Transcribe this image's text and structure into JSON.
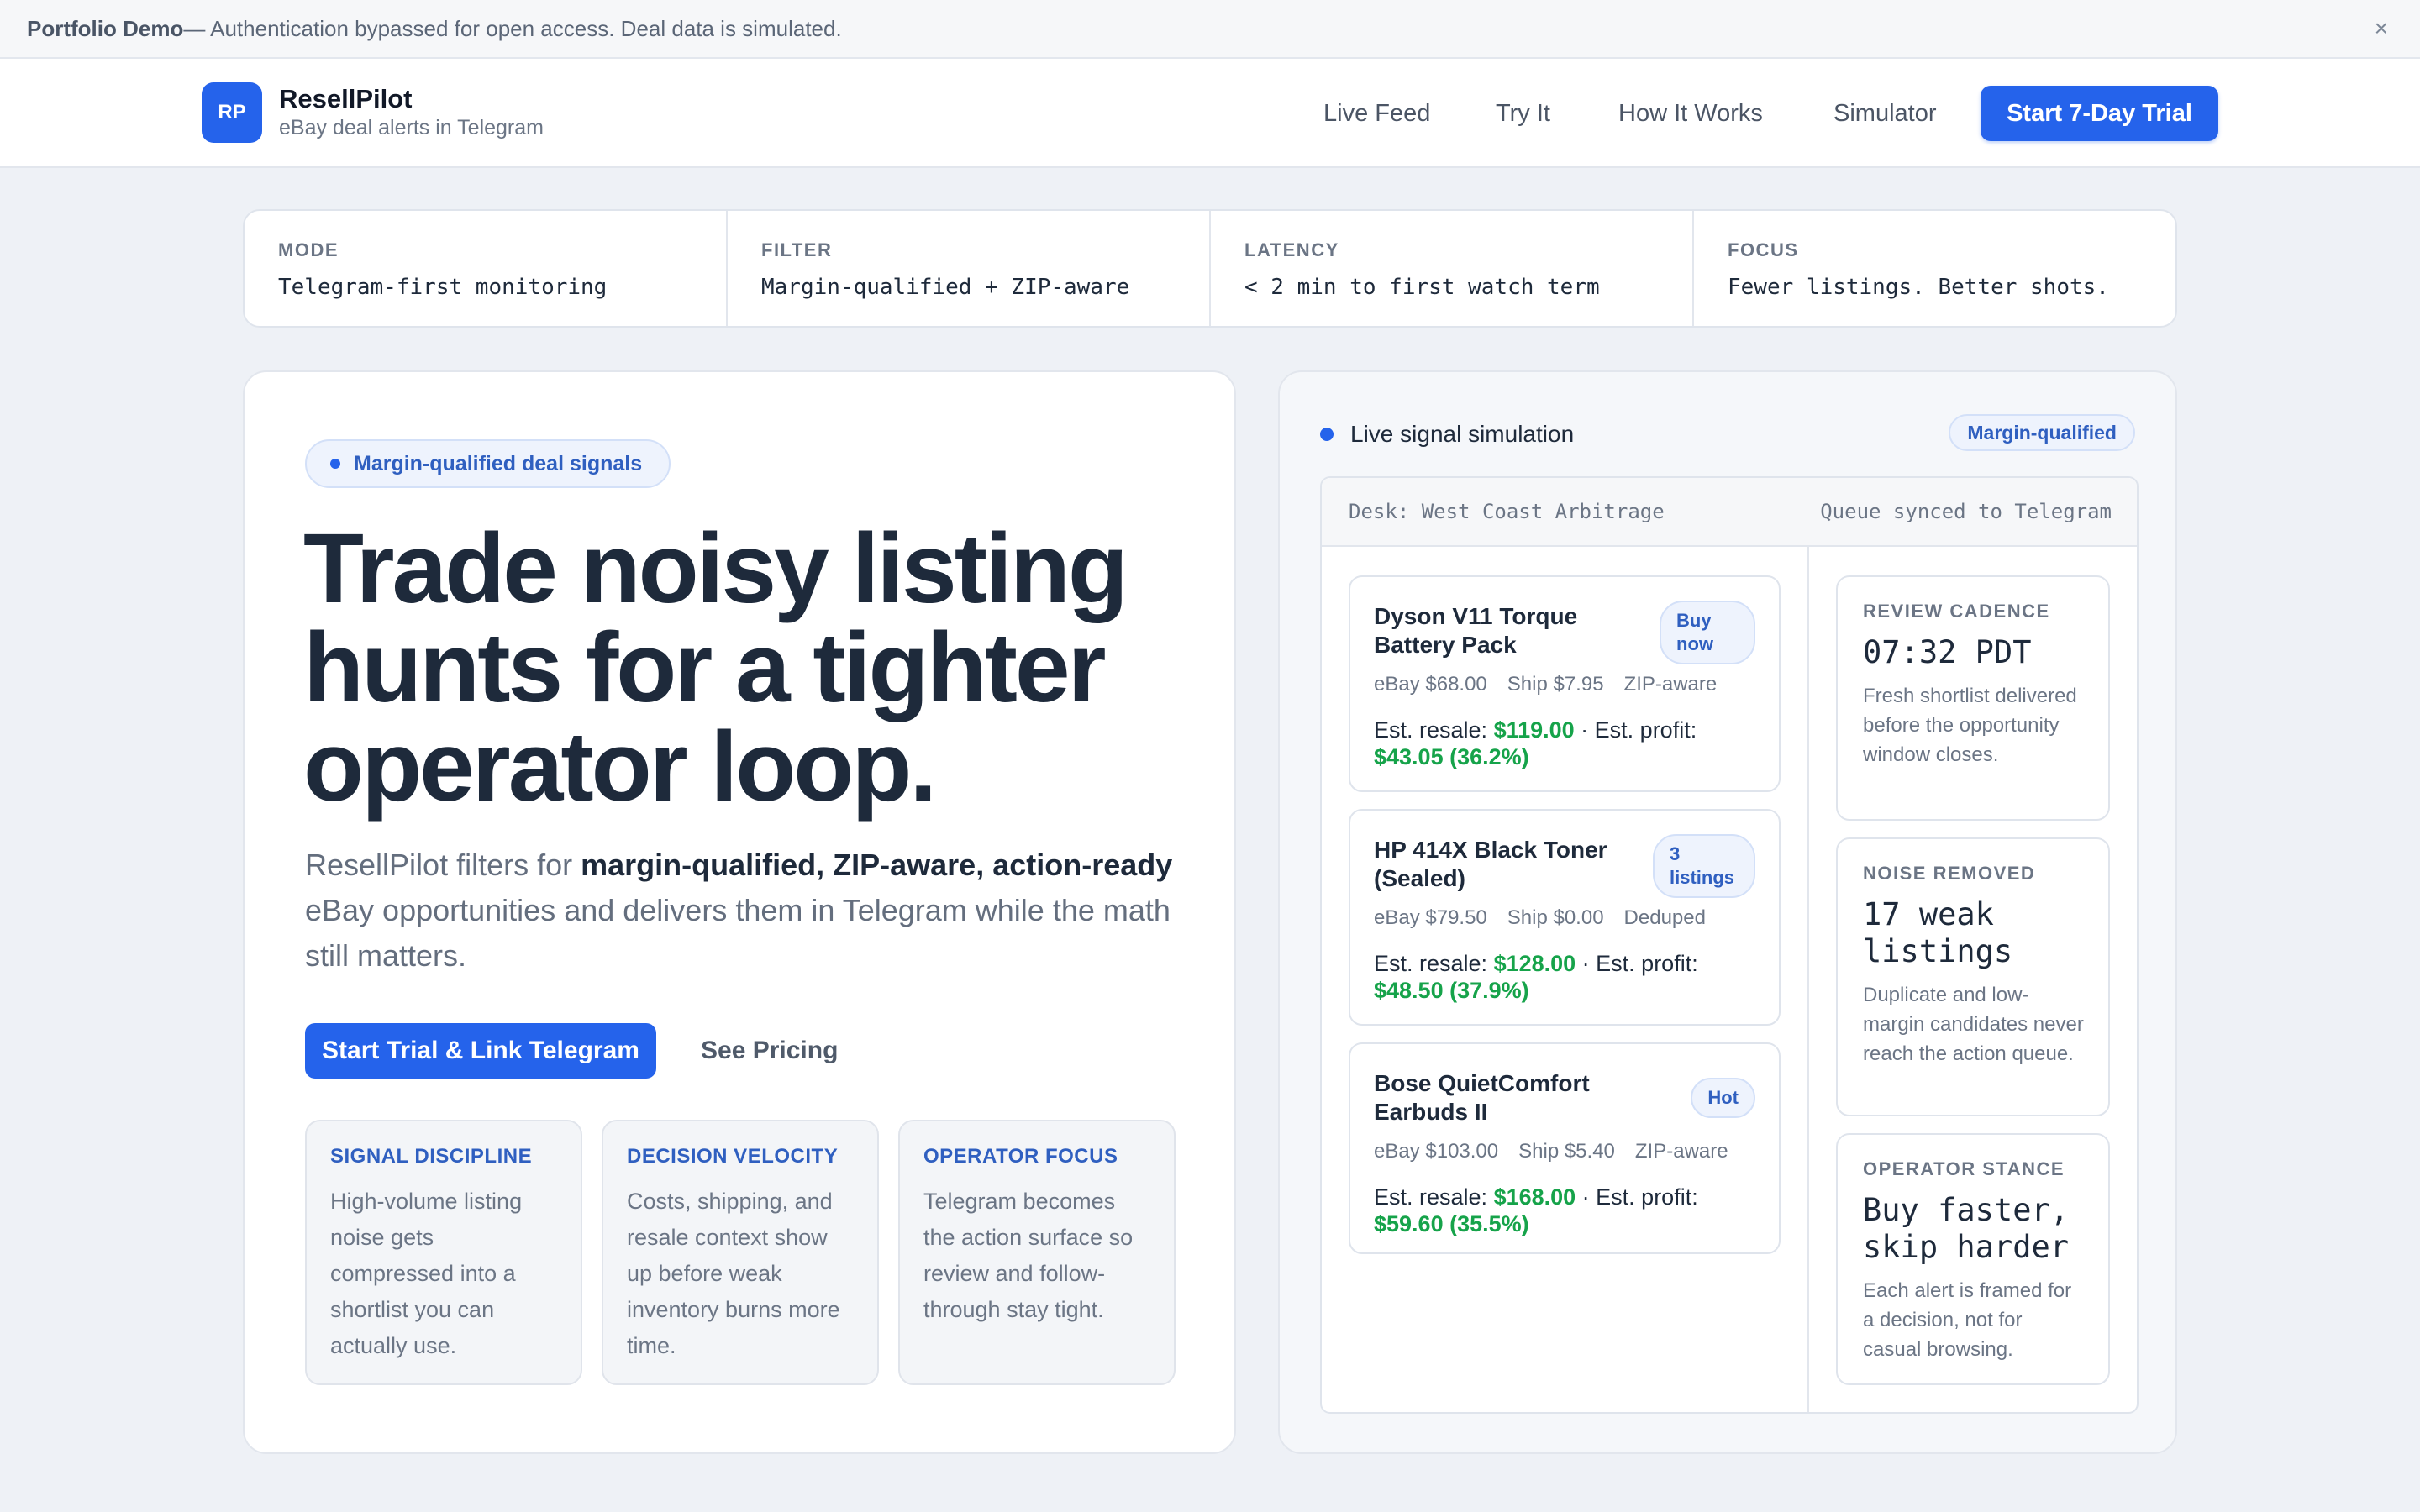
{
  "banner": {
    "title": "Portfolio Demo",
    "message": " — Authentication bypassed for open access. Deal data is simulated.",
    "close": "×"
  },
  "header": {
    "logo": "RP",
    "brand": "ResellPilot",
    "tagline": "eBay deal alerts in Telegram",
    "nav": [
      "Live Feed",
      "Try It",
      "How It Works",
      "Simulator"
    ],
    "cta": "Start 7-Day Trial"
  },
  "stats": [
    {
      "label": "MODE",
      "value": "Telegram-first monitoring"
    },
    {
      "label": "FILTER",
      "value": "Margin-qualified + ZIP-aware"
    },
    {
      "label": "LATENCY",
      "value": "< 2 min to first watch term"
    },
    {
      "label": "FOCUS",
      "value": "Fewer listings. Better shots."
    }
  ],
  "hero": {
    "pill": "Margin-qualified deal signals",
    "title": "Trade noisy listing hunts for a tighter operator loop.",
    "desc_pre": "ResellPilot filters for ",
    "desc_bold": "margin-qualified, ZIP-aware, action-ready",
    "desc_post": " eBay opportunities and delivers them in Telegram while the math still matters.",
    "cta_primary": "Start Trial & Link Telegram",
    "cta_secondary": "See Pricing",
    "features": [
      {
        "title": "SIGNAL DISCIPLINE",
        "text": "High-volume listing noise gets compressed into a shortlist you can actually use."
      },
      {
        "title": "DECISION VELOCITY",
        "text": "Costs, shipping, and resale context show up before weak inventory burns more time."
      },
      {
        "title": "OPERATOR FOCUS",
        "text": "Telegram becomes the action surface so review and follow-through stay tight."
      }
    ]
  },
  "sim": {
    "title": "Live signal simulation",
    "badge": "Margin-qualified",
    "desk": "Desk: West Coast Arbitrage",
    "sync": "Queue synced to Telegram",
    "deals": [
      {
        "title": "Dyson V11 Torque Battery Pack",
        "tag": "Buy now",
        "ebay": "eBay $68.00",
        "ship": "Ship $7.95",
        "note": "ZIP-aware",
        "resale": "$119.00",
        "profit": "$43.05 (36.2%)"
      },
      {
        "title": "HP 414X Black Toner (Sealed)",
        "tag": "3 listings",
        "ebay": "eBay $79.50",
        "ship": "Ship $0.00",
        "note": "Deduped",
        "resale": "$128.00",
        "profit": "$48.50 (37.9%)"
      },
      {
        "title": "Bose QuietComfort Earbuds II",
        "tag": "Hot",
        "ebay": "eBay $103.00",
        "ship": "Ship $5.40",
        "note": "ZIP-aware",
        "resale": "$168.00",
        "profit": "$59.60 (35.5%)"
      }
    ],
    "resale_label": "Est. resale: ",
    "profit_label": " · Est. profit: ",
    "side": [
      {
        "label": "REVIEW CADENCE",
        "value": "07:32 PDT",
        "text": "Fresh shortlist delivered before the opportunity window closes."
      },
      {
        "label": "NOISE REMOVED",
        "value": "17 weak listings",
        "text": "Duplicate and low-margin candidates never reach the action queue."
      },
      {
        "label": "OPERATOR STANCE",
        "value": "Buy faster, skip harder",
        "text": "Each alert is framed for a decision, not for casual browsing."
      }
    ]
  }
}
